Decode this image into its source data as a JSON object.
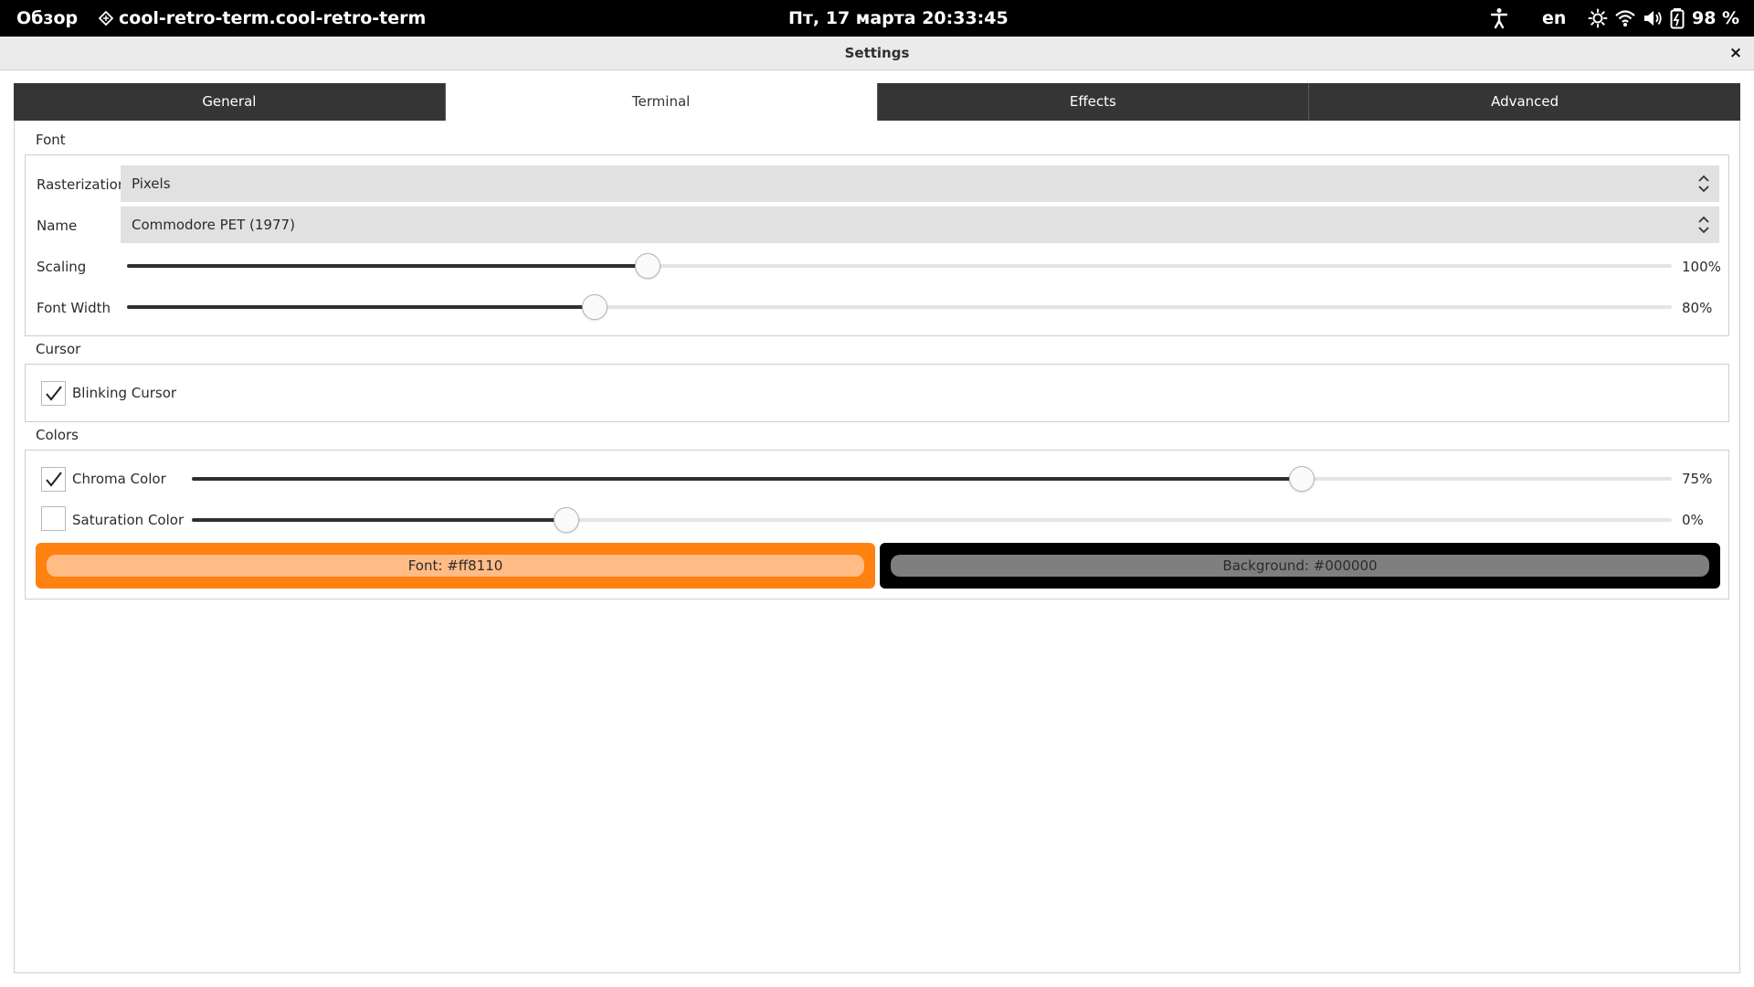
{
  "topbar": {
    "overview": "Обзор",
    "app_name": "cool-retro-term.cool-retro-term",
    "clock": "Пт, 17 марта  20:33:45",
    "lang": "en",
    "battery": "98 %"
  },
  "window": {
    "title": "Settings",
    "close_glyph": "×"
  },
  "tabs": [
    {
      "label": "General"
    },
    {
      "label": "Terminal",
      "active": true
    },
    {
      "label": "Effects"
    },
    {
      "label": "Advanced"
    }
  ],
  "font_section": {
    "title": "Font",
    "rasterization": {
      "label": "Rasterization",
      "value": "Pixels"
    },
    "name": {
      "label": "Name",
      "value": "Commodore PET (1977)"
    },
    "scaling": {
      "label": "Scaling",
      "value_text": "100%",
      "fraction": 0.337
    },
    "font_width": {
      "label": "Font Width",
      "value_text": "80%",
      "fraction": 0.303
    }
  },
  "cursor_section": {
    "title": "Cursor",
    "blinking": {
      "label": "Blinking Cursor",
      "checked": true
    }
  },
  "colors_section": {
    "title": "Colors",
    "chroma": {
      "label": "Chroma Color",
      "checked": true,
      "value_text": "75%",
      "fraction": 0.75
    },
    "saturation": {
      "label": "Saturation Color",
      "checked": false,
      "value_text": "0%",
      "fraction": 0.253
    },
    "font_color": {
      "label": "Font:  #ff8110",
      "color": "#ff8110",
      "inner_color": "#ffbc85"
    },
    "background_color": {
      "label": "Background:  #000000",
      "color": "#000000",
      "inner_color": "#7f7f7f"
    }
  }
}
